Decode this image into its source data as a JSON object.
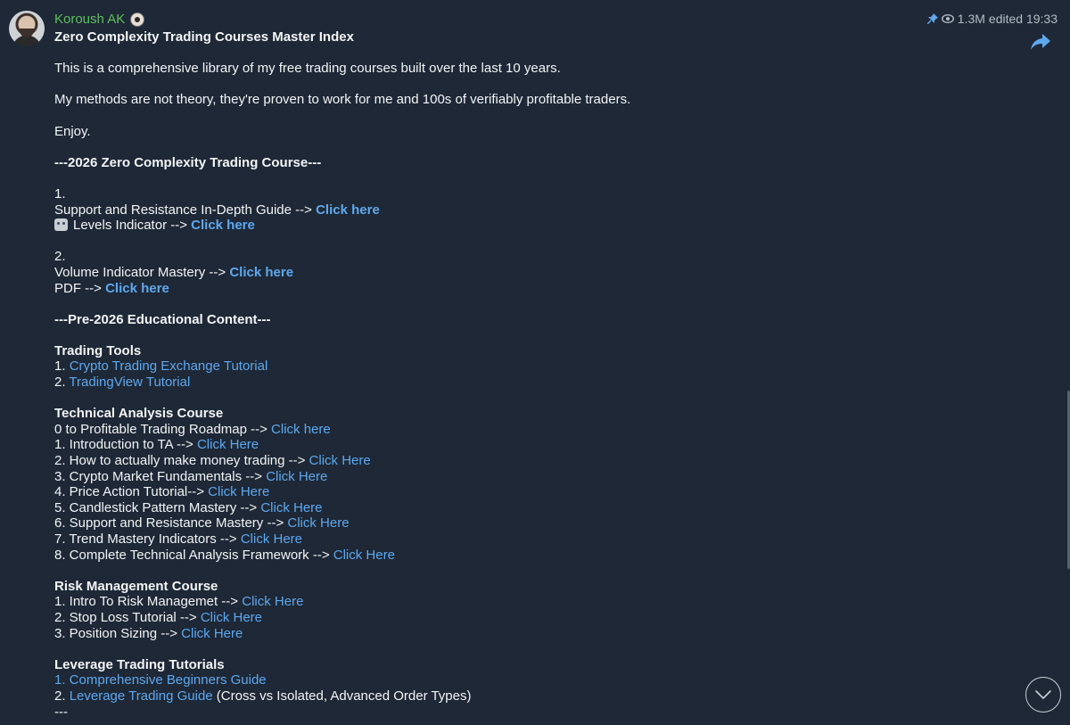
{
  "author": "Koroush AK",
  "meta": {
    "views": "1.3M",
    "edited": "edited 19:33"
  },
  "title": "Zero Complexity Trading Courses Master Index",
  "intro": {
    "p1": "This is a comprehensive library of my free trading courses built over the last 10 years.",
    "p2": "My methods are not theory, they're proven to work for me and 100s of verifiably profitable traders.",
    "p3": "Enjoy."
  },
  "section2026": "---2026 Zero Complexity Trading Course---",
  "item1": {
    "num": "1.",
    "line1": "Support and Resistance In-Depth Guide --> ",
    "link1": "Click here",
    "line2": "Levels Indicator --> ",
    "link2": "Click here"
  },
  "item2": {
    "num": "2.",
    "line1": "Volume Indicator Mastery --> ",
    "link1": "Click here",
    "line2": "PDF --> ",
    "link2": "Click here"
  },
  "sectionPre": "---Pre-2026 Educational Content---",
  "tradingTools": {
    "title": "Trading Tools",
    "items": [
      {
        "num": "1. ",
        "link": "Crypto Trading Exchange Tutorial"
      },
      {
        "num": "2. ",
        "link": "TradingView Tutorial"
      }
    ]
  },
  "ta": {
    "title": "Technical Analysis Course",
    "items": [
      {
        "text": "0 to Profitable Trading Roadmap --> ",
        "link": "Click here"
      },
      {
        "text": "1. Introduction to TA --> ",
        "link": "Click Here"
      },
      {
        "text": "2. How to actually make money trading --> ",
        "link": "Click Here"
      },
      {
        "text": "3. Crypto Market Fundamentals --> ",
        "link": "Click Here"
      },
      {
        "text": "4. Price Action Tutorial--> ",
        "link": "Click Here"
      },
      {
        "text": "5. Candlestick Pattern Mastery --> ",
        "link": "Click Here"
      },
      {
        "text": "6. Support and Resistance Mastery --> ",
        "link": "Click Here"
      },
      {
        "text": "7. Trend Mastery Indicators --> ",
        "link": "Click Here"
      },
      {
        "text": "8. Complete Technical Analysis Framework --> ",
        "link": "Click Here"
      }
    ]
  },
  "risk": {
    "title": "Risk Management Course",
    "items": [
      {
        "text": "1. Intro To Risk Managemet --> ",
        "link": "Click Here"
      },
      {
        "text": "2. Stop Loss Tutorial --> ",
        "link": "Click Here"
      },
      {
        "text": "3. Position Sizing --> ",
        "link": "Click Here"
      }
    ]
  },
  "leverage": {
    "title": "Leverage Trading Tutorials",
    "item1": "1. Comprehensive Beginners Guide",
    "item2_num": "2. ",
    "item2_link": "Leverage Trading Guide",
    "item2_rest": " (Cross vs Isolated, Advanced Order Types)",
    "tail": "---"
  },
  "icons": {
    "pin": "pin-icon",
    "views": "eye-icon",
    "share": "share-icon",
    "scroll": "chevron-down-icon"
  },
  "colors": {
    "background": "#1e2836",
    "author": "#5fbf5f",
    "link": "#5fa8ee",
    "meta": "#b3bcc6"
  }
}
